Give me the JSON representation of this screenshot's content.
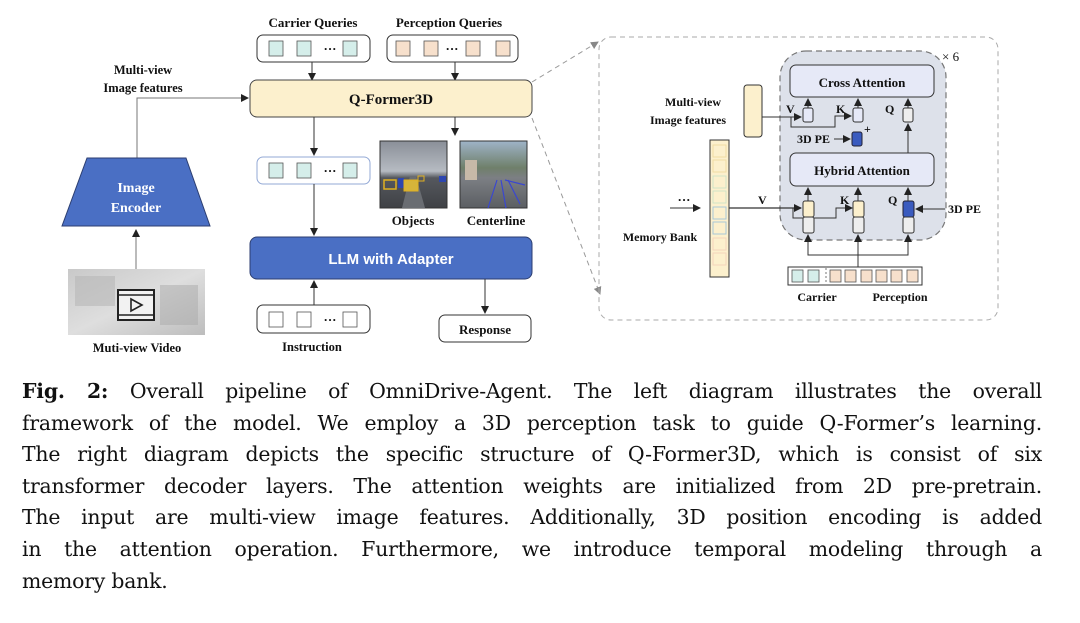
{
  "figure": {
    "left": {
      "carrier_queries_label": "Carrier Queries",
      "perception_queries_label": "Perception Queries",
      "ellipsis": "···",
      "multiview_features_label_line1": "Multi-view",
      "multiview_features_label_line2": "Image features",
      "qformer_label": "Q-Former3D",
      "image_encoder_line1": "Image",
      "image_encoder_line2": "Encoder",
      "video_label": "Muti-view Video",
      "objects_label": "Objects",
      "centerline_label": "Centerline",
      "llm_label": "LLM with Adapter",
      "instruction_label": "Instruction",
      "response_label": "Response"
    },
    "right": {
      "repeat_label": "× 6",
      "cross_attention_label": "Cross Attention",
      "hybrid_attention_label": "Hybrid Attention",
      "multiview_features_label_line1": "Multi-view",
      "multiview_features_label_line2": "Image features",
      "memory_bank_label": "Memory Bank",
      "ellipsis": "···",
      "v_label": "V",
      "k_label": "K",
      "q_label": "Q",
      "pe_label": "3D PE",
      "plus": "+",
      "carrier_label": "Carrier",
      "perception_label": "Perception"
    },
    "colors": {
      "carrier_query": "#d5eeea",
      "perception_query": "#f7e0cc",
      "qformer_fill": "#fcf0cd",
      "encoder_blue": "#4a6fc4",
      "pe_blue": "#3a5bbf",
      "layer_bg": "#dde1ea",
      "attention_fill": "#e6e9f7"
    }
  },
  "caption": {
    "label": "Fig. 2:",
    "lines": [
      " Overall pipeline of OmniDrive-Agent. The left diagram illustrates the overall",
      "framework of the model. We employ a 3D perception task to guide Q-Former’s learning.",
      "The right diagram depicts the specific structure of Q-Former3D, which is consist of six",
      "transformer decoder layers. The attention weights are initialized from 2D pre-pretrain.",
      "The input are multi-view image features. Additionally, 3D position encoding is added",
      "in the attention operation. Furthermore, we introduce temporal modeling through a",
      "memory bank."
    ]
  }
}
